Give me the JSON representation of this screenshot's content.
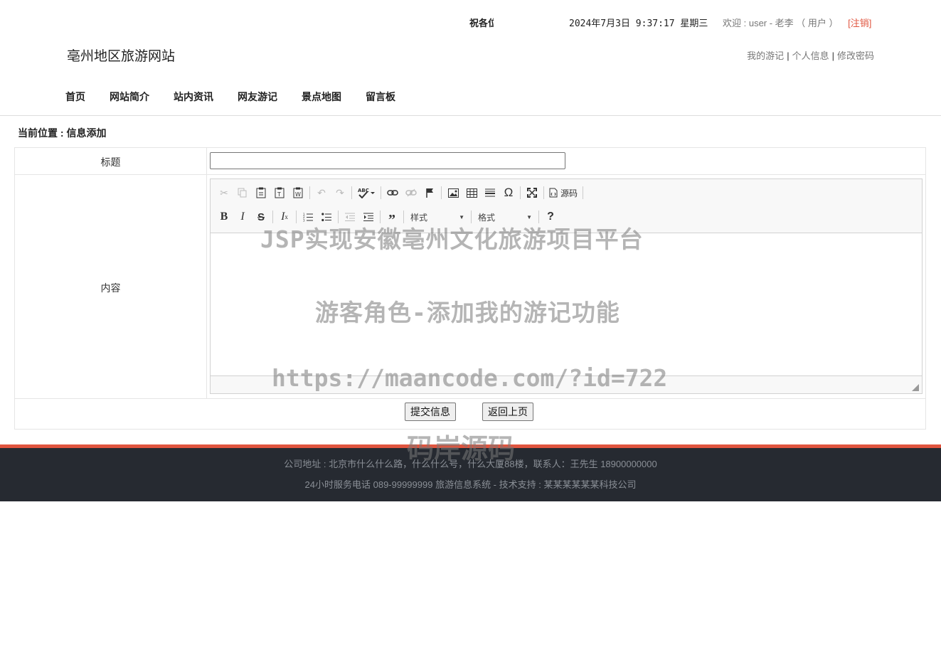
{
  "topbar": {
    "marquee": "祝各位",
    "datetime": "2024年7月3日 9:37:17 星期三",
    "welcome": "欢迎 : user - 老李 （ 用户 ）",
    "logout": "[注销]"
  },
  "header": {
    "site_title": "亳州地区旅游网站",
    "user_links": [
      "我的游记",
      "个人信息",
      "修改密码"
    ]
  },
  "nav": [
    "首页",
    "网站简介",
    "站内资讯",
    "网友游记",
    "景点地图",
    "留言板"
  ],
  "breadcrumb": "当前位置 : 信息添加",
  "form": {
    "title_label": "标题",
    "title_value": "",
    "content_label": "内容",
    "source_label": "源码",
    "style_combo": "样式",
    "format_combo": "格式",
    "submit_label": "提交信息",
    "back_label": "返回上页"
  },
  "watermark": {
    "line1": "JSP实现安徽亳州文化旅游项目平台",
    "line2": "游客角色-添加我的游记功能",
    "line3": "https://maancode.com/?id=722",
    "line4": "码岸源码"
  },
  "footer": {
    "line1": "公司地址 : 北京市什么什么路，什么什么号，什么大厦88楼，联系人：王先生 18900000000",
    "line2": "24小时服务电话   089-99999999   旅游信息系统 - 技术支持 : 某某某某某某科技公司"
  },
  "colors": {
    "accent_red": "#e0553f",
    "footer_bg": "#262a31"
  }
}
